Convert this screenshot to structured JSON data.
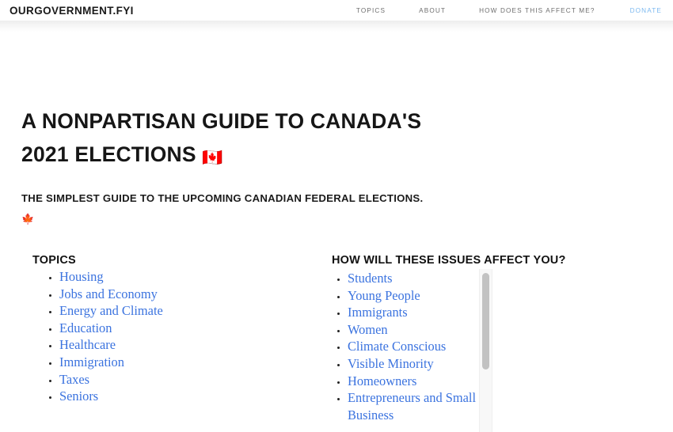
{
  "header": {
    "brand": "OURGOVERNMENT.FYI",
    "nav": [
      {
        "label": "TOPICS",
        "name": "nav-link-topics",
        "accent": false
      },
      {
        "label": "ABOUT",
        "name": "nav-link-about",
        "accent": false
      },
      {
        "label": "HOW DOES THIS AFFECT ME?",
        "name": "nav-link-how-does-this-affect-me",
        "accent": false
      },
      {
        "label": "DONATE",
        "name": "nav-link-donate",
        "accent": true
      }
    ]
  },
  "hero": {
    "title_line1": "A NONPARTISAN GUIDE TO CANADA'S",
    "title_line2": "2021 ELECTIONS",
    "title_emoji": "🇨🇦",
    "title_emoji_name": "canada-flag-emoji",
    "subtitle": "THE SIMPLEST GUIDE TO THE UPCOMING CANADIAN FEDERAL ELECTIONS.",
    "subtitle_emoji": "🍁",
    "subtitle_emoji_name": "maple-leaf-emoji"
  },
  "topics": {
    "heading": "TOPICS",
    "items": [
      "Housing",
      "Jobs and Economy",
      "Energy and Climate",
      "Education",
      "Healthcare",
      "Immigration",
      "Taxes",
      "Seniors"
    ]
  },
  "audiences": {
    "heading": "HOW WILL THESE ISSUES AFFECT YOU?",
    "items": [
      "Students",
      "Young People",
      "Immigrants",
      "Women",
      "Climate Conscious",
      "Visible Minority",
      "Homeowners",
      "Entrepreneurs and Small Business"
    ]
  },
  "colors": {
    "link_blue": "#3b73df",
    "donate_blue": "#7cb9f0",
    "text_dark": "#161616",
    "nav_gray": "#6e6e6e",
    "scrollbar_thumb": "#c2c2c2"
  }
}
